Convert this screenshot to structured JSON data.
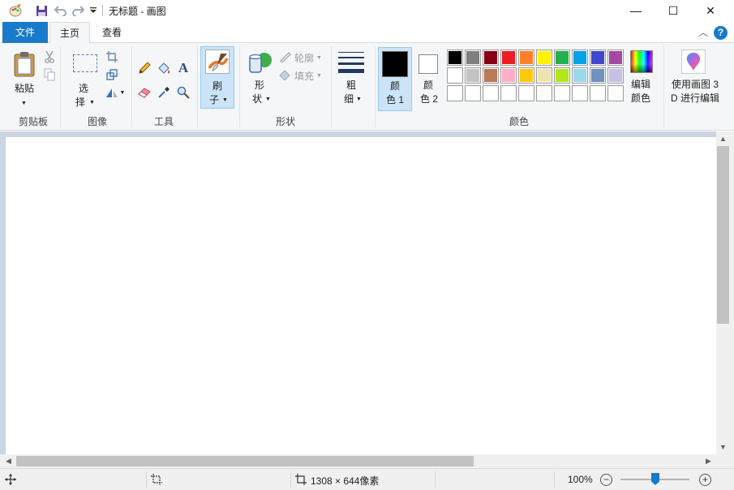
{
  "window": {
    "title": "无标题 - 画图",
    "controls": {
      "minimize": "—",
      "maximize": "☐",
      "close": "✕"
    }
  },
  "quick_access": [
    "paint-app-icon",
    "save-icon",
    "undo-icon",
    "redo-icon",
    "customize-dropdown-icon"
  ],
  "tabs": {
    "file": "文件",
    "home": "主页",
    "view": "查看"
  },
  "ribbon": {
    "clipboard": {
      "label": "剪贴板",
      "paste": "粘贴",
      "icons": [
        "paste-icon",
        "cut-icon",
        "copy-icon"
      ]
    },
    "image": {
      "label": "图像",
      "select_top": "选",
      "select_bottom": "择",
      "icons": [
        "select-icon",
        "crop-icon",
        "resize-icon",
        "rotate-icon"
      ]
    },
    "tools": {
      "label": "工具",
      "icons": [
        "pencil-icon",
        "fill-icon",
        "text-icon",
        "eraser-icon",
        "color-picker-icon",
        "magnifier-icon"
      ]
    },
    "brush": {
      "top": "刷",
      "bottom": "子"
    },
    "shapes": {
      "label": "形状",
      "shapes_top": "形",
      "shapes_bottom": "状",
      "outline": "轮廓",
      "fill": "填充"
    },
    "size": {
      "top": "粗",
      "bottom": "细"
    },
    "colors": {
      "label": "颜色",
      "color1_top": "颜",
      "color1_bottom": "色 1",
      "color2_top": "颜",
      "color2_bottom": "色 2",
      "edit_top": "编辑",
      "edit_bottom": "颜色",
      "color1_value": "#000000",
      "color2_value": "#ffffff",
      "palette_row1": [
        "#000000",
        "#7f7f7f",
        "#880015",
        "#ed1c24",
        "#ff7f27",
        "#fff200",
        "#22b14c",
        "#00a2e8",
        "#3f48cc",
        "#a349a4"
      ],
      "palette_row2": [
        "#ffffff",
        "#c3c3c3",
        "#b97a57",
        "#ffaec9",
        "#ffc90e",
        "#efe4b0",
        "#b5e61d",
        "#99d9ea",
        "#7092be",
        "#c8bfe7"
      ],
      "palette_row3": [
        "#ffffff",
        "#ffffff",
        "#ffffff",
        "#ffffff",
        "#ffffff",
        "#ffffff",
        "#ffffff",
        "#ffffff",
        "#ffffff",
        "#ffffff"
      ]
    },
    "paint3d": {
      "line1": "使用画图 3",
      "line2": "D 进行编辑"
    }
  },
  "status": {
    "canvas_size": "1308 × 644像素",
    "zoom": "100%",
    "zoom_level_fraction": 0.5
  }
}
